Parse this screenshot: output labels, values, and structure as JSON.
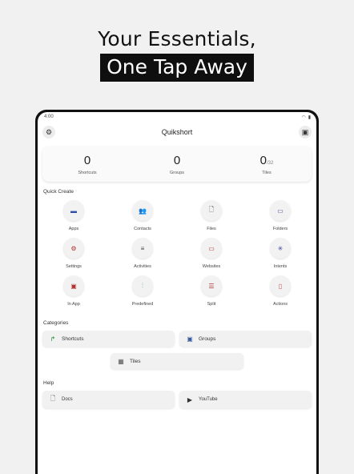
{
  "headline": {
    "line1": "Your Essentials,",
    "line2": "One Tap Away"
  },
  "device": {
    "status_time": "4:00",
    "app_title": "Quikshort",
    "settings_icon": "gear-icon",
    "save_icon": "save-icon"
  },
  "counts": [
    {
      "value": "0",
      "denom": "",
      "label": "Shortcuts"
    },
    {
      "value": "0",
      "denom": "",
      "label": "Groups"
    },
    {
      "value": "0",
      "denom": "/32",
      "label": "Tiles"
    }
  ],
  "quick_create": {
    "title": "Quick Create",
    "items": [
      {
        "label": "Apps",
        "icon": "android-icon",
        "glyph": "▬",
        "color": "#2f4fa8"
      },
      {
        "label": "Contacts",
        "icon": "contacts-icon",
        "glyph": "👥",
        "color": "#2e8b3a"
      },
      {
        "label": "Files",
        "icon": "file-icon",
        "glyph": "🗋",
        "color": "#444444"
      },
      {
        "label": "Folders",
        "icon": "folder-icon",
        "glyph": "▭",
        "color": "#5b3fa0"
      },
      {
        "label": "Settings",
        "icon": "settings-gear-icon",
        "glyph": "⚙",
        "color": "#b03030"
      },
      {
        "label": "Activities",
        "icon": "list-icon",
        "glyph": "≡",
        "color": "#444444"
      },
      {
        "label": "Websites",
        "icon": "website-icon",
        "glyph": "▭",
        "color": "#b03030"
      },
      {
        "label": "Intents",
        "icon": "hub-icon",
        "glyph": "✳",
        "color": "#3a3aa0"
      },
      {
        "label": "In App",
        "icon": "in-app-icon",
        "glyph": "▣",
        "color": "#b03030"
      },
      {
        "label": "Predefined",
        "icon": "sliders-icon",
        "glyph": "⫶",
        "color": "#2e8b3a"
      },
      {
        "label": "Split",
        "icon": "split-icon",
        "glyph": "☰",
        "color": "#b03030"
      },
      {
        "label": "Actions",
        "icon": "action-icon",
        "glyph": "▯",
        "color": "#c0504d"
      }
    ]
  },
  "categories": {
    "title": "Categories",
    "items": [
      {
        "label": "Shortcuts",
        "icon": "shortcut-arrow-icon",
        "glyph": "↱",
        "color": "#2e8b3a"
      },
      {
        "label": "Groups",
        "icon": "groups-icon",
        "glyph": "▣",
        "color": "#3a5aa0"
      },
      {
        "label": "Tiles",
        "icon": "tiles-icon",
        "glyph": "▦",
        "color": "#555555"
      }
    ]
  },
  "help": {
    "title": "Help",
    "items": [
      {
        "label": "Docs",
        "icon": "doc-icon",
        "glyph": "🗋",
        "color": "#555555"
      },
      {
        "label": "YouTube",
        "icon": "youtube-icon",
        "glyph": "▶",
        "color": "#333333"
      }
    ]
  }
}
